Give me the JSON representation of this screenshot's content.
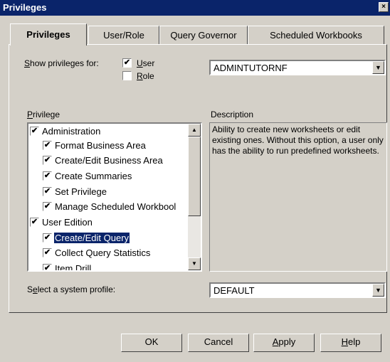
{
  "window": {
    "title": "Privileges",
    "close_glyph": "×"
  },
  "tabs": [
    {
      "label": "Privileges",
      "active": true
    },
    {
      "label": "User/Role"
    },
    {
      "label": "Query Governor"
    },
    {
      "label": "Scheduled Workbooks"
    }
  ],
  "show_privileges": {
    "label_prefix": "S",
    "label_rest": "how privileges for:",
    "user": {
      "underline": "U",
      "rest": "ser",
      "checked": true
    },
    "role": {
      "underline": "R",
      "rest": "ole",
      "checked": false
    },
    "selected_user": "ADMINTUTORNF"
  },
  "privilege_list": {
    "label_prefix": "P",
    "label_rest": "rivilege",
    "items": [
      {
        "label": "Administration",
        "checked": true,
        "level": 0
      },
      {
        "label": "Format Business Area",
        "checked": true,
        "level": 1
      },
      {
        "label": "Create/Edit Business Area",
        "checked": true,
        "level": 1
      },
      {
        "label": "Create Summaries",
        "checked": true,
        "level": 1
      },
      {
        "label": "Set Privilege",
        "checked": true,
        "level": 1
      },
      {
        "label": "Manage Scheduled Workbool",
        "checked": true,
        "level": 1
      },
      {
        "label": "User Edition",
        "checked": true,
        "level": 0
      },
      {
        "label": "Create/Edit Query",
        "checked": true,
        "level": 1,
        "selected": true
      },
      {
        "label": "Collect Query Statistics",
        "checked": true,
        "level": 1
      },
      {
        "label": "Item Drill",
        "checked": true,
        "level": 1
      }
    ]
  },
  "description": {
    "label": "Description",
    "text": "Ability to create new worksheets or edit existing ones. Without this option, a user only has the ability to run predefined worksheets."
  },
  "system_profile": {
    "label_a": "S",
    "label_u": "e",
    "label_rest": "lect a system profile:",
    "value": "DEFAULT"
  },
  "buttons": {
    "ok": "OK",
    "cancel": "Cancel",
    "apply_u": "A",
    "apply_rest": "pply",
    "help_u": "H",
    "help_rest": "elp"
  },
  "icons": {
    "checkbox_mark": "✔",
    "arrow_down": "▼",
    "arrow_up": "▲"
  },
  "colors": {
    "title_bar": "#0a246a",
    "face": "#d4d0c8",
    "selection": "#0a246a"
  }
}
